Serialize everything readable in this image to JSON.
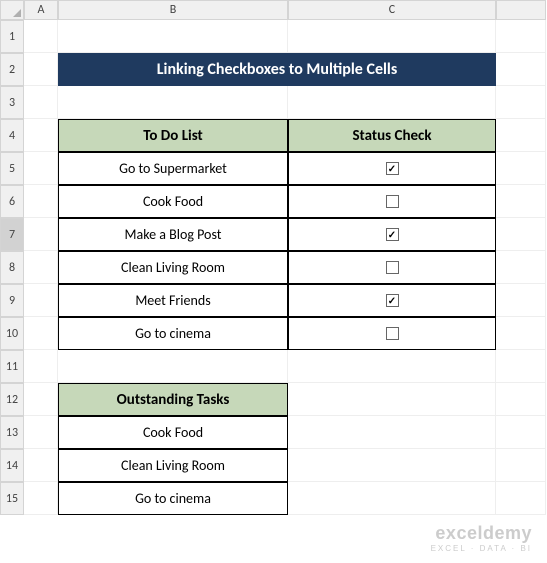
{
  "columns": [
    "A",
    "B",
    "C"
  ],
  "rows": [
    "1",
    "2",
    "3",
    "4",
    "5",
    "6",
    "7",
    "8",
    "9",
    "10",
    "11",
    "12",
    "13",
    "14",
    "15"
  ],
  "selectedRow": 7,
  "title": "Linking Checkboxes to Multiple Cells",
  "headers": {
    "todo": "To Do List",
    "status": "Status Check",
    "outstanding": "Outstanding Tasks"
  },
  "tasks": [
    {
      "label": "Go to Supermarket",
      "checked": true
    },
    {
      "label": "Cook Food",
      "checked": false
    },
    {
      "label": "Make a Blog Post",
      "checked": true
    },
    {
      "label": "Clean Living Room",
      "checked": false
    },
    {
      "label": "Meet Friends",
      "checked": true
    },
    {
      "label": "Go to cinema",
      "checked": false
    }
  ],
  "outstanding": [
    "Cook Food",
    "Clean Living Room",
    "Go to cinema"
  ],
  "watermark": {
    "brand": "exceldemy",
    "tag": "EXCEL · DATA · BI"
  }
}
